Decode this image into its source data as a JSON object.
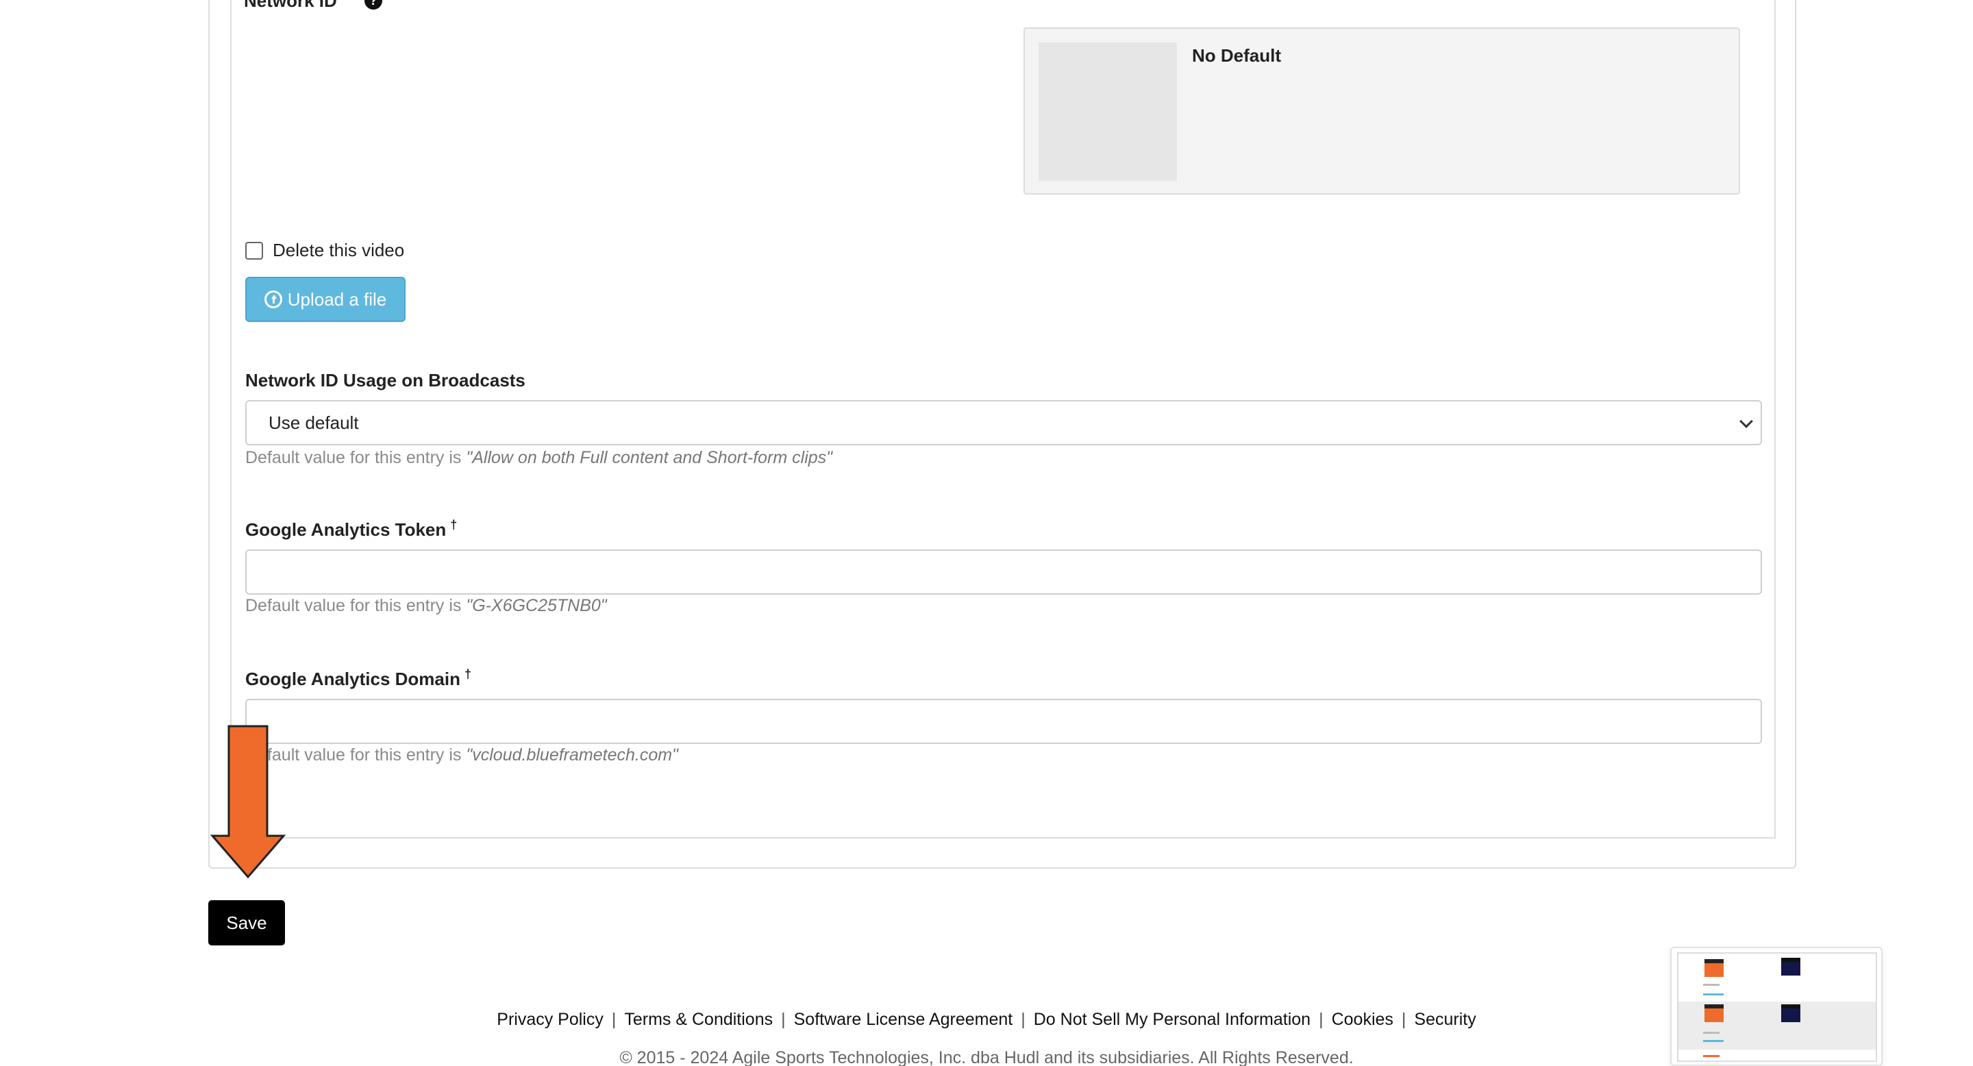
{
  "network_id": {
    "label": "Network ID",
    "help_icon": "?",
    "preview_title": "No Default"
  },
  "delete": {
    "label": "Delete this video",
    "checked": false
  },
  "upload": {
    "label": "Upload a file",
    "icon": "upload-circle-icon"
  },
  "usage": {
    "label": "Network ID Usage on Broadcasts",
    "selected": "Use default",
    "hint_prefix": "Default value for this entry is ",
    "hint_value": "\"Allow on both Full content and Short-form clips\""
  },
  "ga_token": {
    "label": "Google Analytics Token",
    "marker": "†",
    "value": "",
    "hint_prefix": "Default value for this entry is ",
    "hint_value": "\"G-X6GC25TNB0\""
  },
  "ga_domain": {
    "label": "Google Analytics Domain",
    "marker": "†",
    "value": "",
    "hint_prefix": "Default value for this entry is ",
    "hint_value": "\"vcloud.blueframetech.com\""
  },
  "save": {
    "label": "Save"
  },
  "footer": {
    "links": [
      "Privacy Policy",
      "Terms & Conditions",
      "Software License Agreement",
      "Do Not Sell My Personal Information",
      "Cookies",
      "Security"
    ],
    "separator": "|",
    "copyright": "© 2015 - 2024 Agile Sports Technologies, Inc. dba Hudl and its subsidiaries. All Rights Reserved."
  },
  "colors": {
    "upload_button": "#5fb8de",
    "save_button": "#000000",
    "annotation_arrow": "#ef6b2b"
  }
}
